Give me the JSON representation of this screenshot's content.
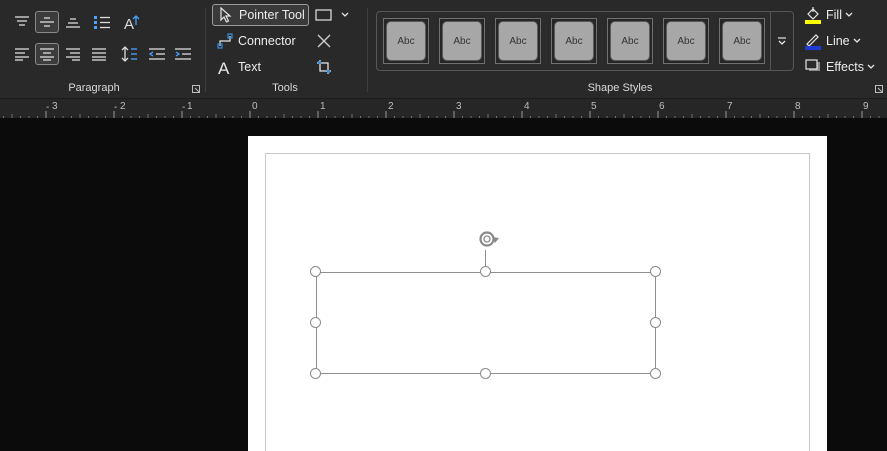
{
  "ribbon": {
    "paragraph": {
      "label": "Paragraph"
    },
    "tools": {
      "label": "Tools",
      "pointer_tool": "Pointer Tool",
      "connector": "Connector",
      "text": "Text"
    },
    "shape_styles": {
      "label": "Shape Styles",
      "swatch_label": "Abc",
      "swatches": [
        "Abc",
        "Abc",
        "Abc",
        "Abc",
        "Abc",
        "Abc",
        "Abc"
      ]
    },
    "format": {
      "fill": "Fill",
      "line": "Line",
      "effects": "Effects"
    }
  },
  "ruler": {
    "numbers": [
      "3",
      "2",
      "1",
      "0",
      "1",
      "2",
      "3",
      "4",
      "5",
      "6",
      "7",
      "8",
      "9"
    ]
  },
  "colors": {
    "ribbon_bg": "#292929",
    "fill_accent": "#ffff00",
    "line_accent": "#1f3bd6",
    "connector_accent": "#3b8ede",
    "swatch_fill": "#a7a7a7",
    "page_bg": "#ffffff"
  }
}
